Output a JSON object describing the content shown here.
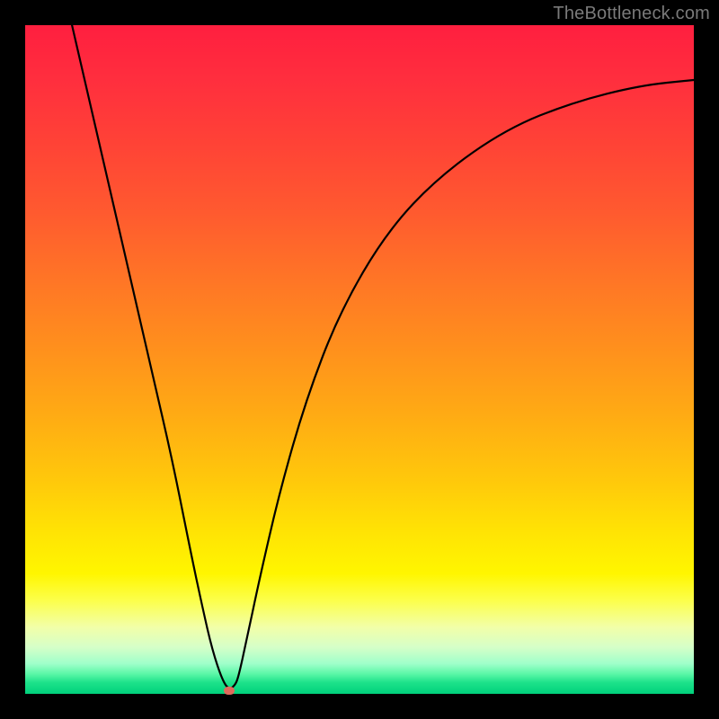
{
  "watermark": "TheBottleneck.com",
  "chart_data": {
    "type": "line",
    "title": "",
    "xlabel": "",
    "ylabel": "",
    "xlim": [
      0,
      1
    ],
    "ylim": [
      0,
      1
    ],
    "series": [
      {
        "name": "bottleneck-curve",
        "x": [
          0.07,
          0.1,
          0.13,
          0.16,
          0.19,
          0.22,
          0.25,
          0.265,
          0.28,
          0.295,
          0.305,
          0.315,
          0.32,
          0.33,
          0.35,
          0.38,
          0.42,
          0.47,
          0.54,
          0.62,
          0.72,
          0.82,
          0.92,
          1.0
        ],
        "y": [
          1.0,
          0.87,
          0.74,
          0.61,
          0.48,
          0.35,
          0.2,
          0.13,
          0.065,
          0.02,
          0.006,
          0.014,
          0.03,
          0.075,
          0.17,
          0.3,
          0.44,
          0.57,
          0.69,
          0.775,
          0.845,
          0.885,
          0.91,
          0.918
        ]
      }
    ],
    "marker": {
      "x": 0.305,
      "y": 0.006,
      "color": "#e06a5c"
    },
    "background_gradient": {
      "direction": "vertical",
      "stops": [
        {
          "pos": 0.0,
          "color": "#ff1f3f"
        },
        {
          "pos": 0.5,
          "color": "#ff9a18"
        },
        {
          "pos": 0.82,
          "color": "#fff600"
        },
        {
          "pos": 0.95,
          "color": "#9fffca"
        },
        {
          "pos": 1.0,
          "color": "#00d17c"
        }
      ]
    }
  }
}
